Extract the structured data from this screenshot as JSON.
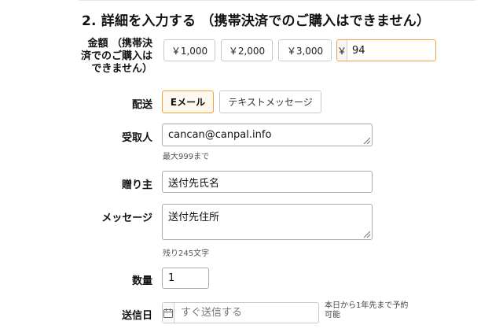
{
  "section": {
    "title": "2. 詳細を入力する （携帯決済でのご購入はできません）"
  },
  "amount": {
    "label": "金額 （携帯決済でのご購入はできません）",
    "preset_1": "￥1,000",
    "preset_2": "￥2,000",
    "preset_3": "￥3,000",
    "currency_symbol": "￥",
    "value": "94"
  },
  "delivery": {
    "label": "配送",
    "option_email": "Eメール",
    "option_sms": "テキストメッセージ",
    "selected": "Eメール"
  },
  "recipient": {
    "label": "受取人",
    "value": "cancan@canpal.info",
    "hint": "最大999まで"
  },
  "sender": {
    "label": "贈り主",
    "value": "送付先氏名"
  },
  "message": {
    "label": "メッセージ",
    "value": "送付先住所",
    "hint": "残り245文字"
  },
  "quantity": {
    "label": "数量",
    "value": "1"
  },
  "send_date": {
    "label": "送信日",
    "placeholder": "すぐ送信する",
    "icon": "calendar-icon",
    "note": "本日から1年先まで予約可能"
  },
  "colors": {
    "accent_border": "#f0a33a",
    "selected_fill": "#fff8ee",
    "border": "#c9c9c9"
  }
}
